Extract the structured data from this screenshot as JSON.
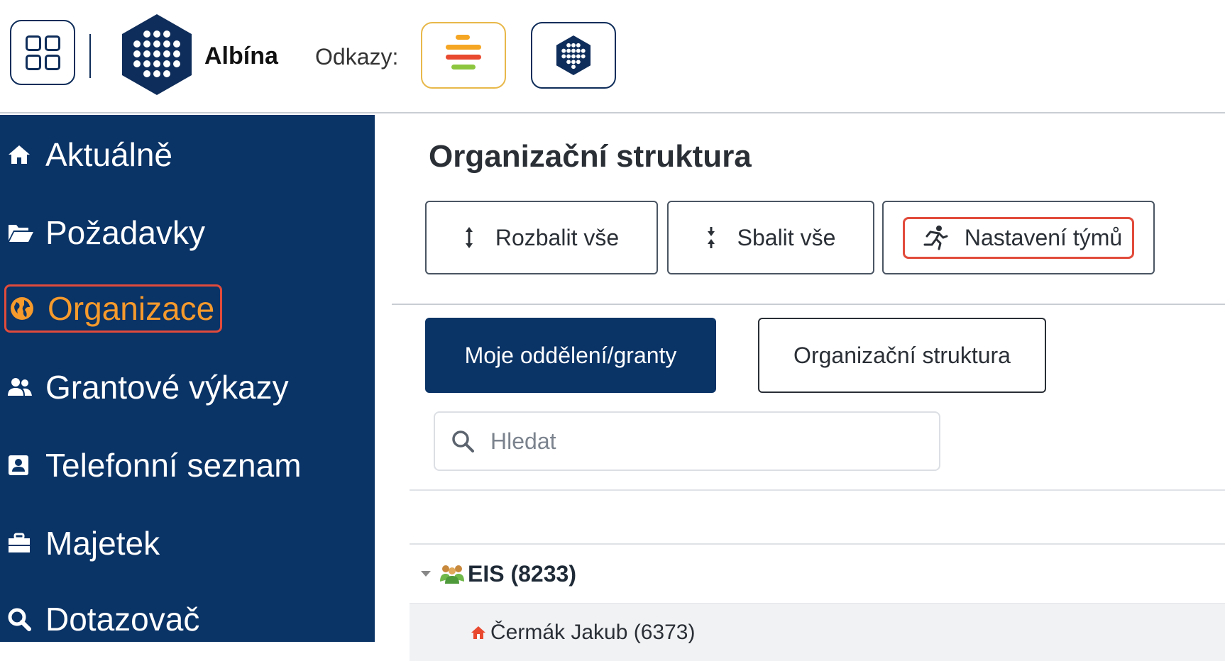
{
  "header": {
    "brand": "Albína",
    "links_label": "Odkazy:"
  },
  "sidebar": {
    "items": [
      {
        "label": "Aktuálně",
        "icon": "home-icon"
      },
      {
        "label": "Požadavky",
        "icon": "folder-open-icon"
      },
      {
        "label": "Organizace",
        "icon": "globe-icon",
        "active": true
      },
      {
        "label": "Grantové výkazy",
        "icon": "users-icon"
      },
      {
        "label": "Telefonní seznam",
        "icon": "contact-card-icon"
      },
      {
        "label": "Majetek",
        "icon": "toolbox-icon"
      },
      {
        "label": "Dotazovač",
        "icon": "search-icon"
      }
    ]
  },
  "main": {
    "title": "Organizační struktura",
    "toolbar": {
      "expand_all": "Rozbalit vše",
      "collapse_all": "Sbalit vše",
      "team_settings": "Nastavení týmů"
    },
    "tabs": [
      {
        "label": "Moje oddělení/granty",
        "active": true
      },
      {
        "label": "Organizační struktura",
        "active": false
      }
    ],
    "search": {
      "placeholder": "Hledat"
    },
    "tree": [
      {
        "label": "EIS (8233)",
        "icon": "group-icon",
        "expanded": true
      },
      {
        "label": "Čermák Jakub (6373)",
        "icon": "home-person-icon"
      }
    ]
  },
  "colors": {
    "sidebar_bg": "#0a3366",
    "active_text": "#f59a2c",
    "highlight_border": "#e14b3b",
    "link1_border": "#e8b84a"
  }
}
